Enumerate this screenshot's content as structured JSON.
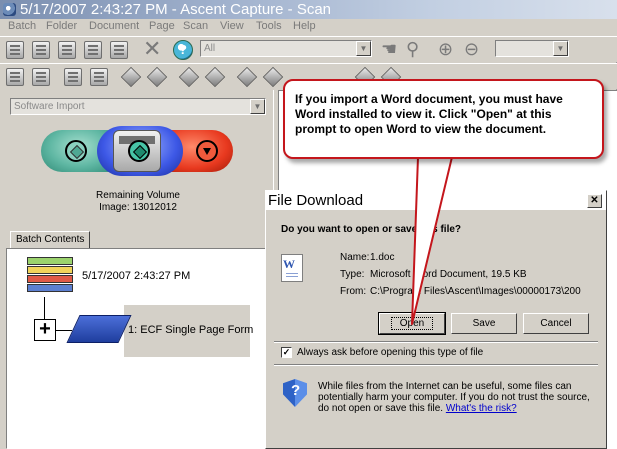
{
  "window": {
    "title": "5/17/2007 2:43:27 PM - Ascent Capture - Scan"
  },
  "menu": [
    "Batch",
    "Folder",
    "Document",
    "Page",
    "Scan",
    "View",
    "Tools",
    "Help"
  ],
  "toolbar": {
    "filter_value": "All",
    "zoom_value": ""
  },
  "left": {
    "source_select": "Software Import",
    "remaining_label": "Remaining Volume",
    "image_count": "Image: 13012012",
    "tab_label": "Batch Contents",
    "batch_date": "5/17/2007 2:43:27 PM",
    "expand_symbol": "+",
    "document_label": "1: ECF Single Page Form"
  },
  "callout": {
    "text": "If you import a Word document, you must have Word installed to view it. Click \"Open\" at this prompt to open Word to view the document."
  },
  "dialog": {
    "title": "File Download",
    "close_label": "✕",
    "question_before": "Do you want to open or save ",
    "question_hidden": "this",
    "question_after": " file?",
    "name_label": "Name:",
    "name_value": "1.doc",
    "type_label": "Type:",
    "type_value": "Microsoft Word Document, 19.5 KB",
    "from_label": "From:",
    "from_value": "C:\\Program Files\\Ascent\\Images\\00000173\\200",
    "open_label": "Open",
    "save_label": "Save",
    "cancel_label": "Cancel",
    "checkbox_mark": "✓",
    "checkbox_label": "Always ask before opening this type of file",
    "warning_text": "While files from the Internet can be useful, some files can potentially harm your computer. If you do not trust the source, do not open or save this file. ",
    "risk_link": "What's the risk?"
  },
  "icons": [
    "app-icon",
    "document-icon",
    "delete-x-icon",
    "help-icon",
    "hand-icon",
    "magnifier-icon",
    "zoom-in-icon",
    "zoom-out-icon",
    "batch-tray-icon",
    "word-document-icon",
    "shield-icon"
  ],
  "colors": {
    "callout_border": "#c4161c",
    "link": "#0000cc"
  }
}
